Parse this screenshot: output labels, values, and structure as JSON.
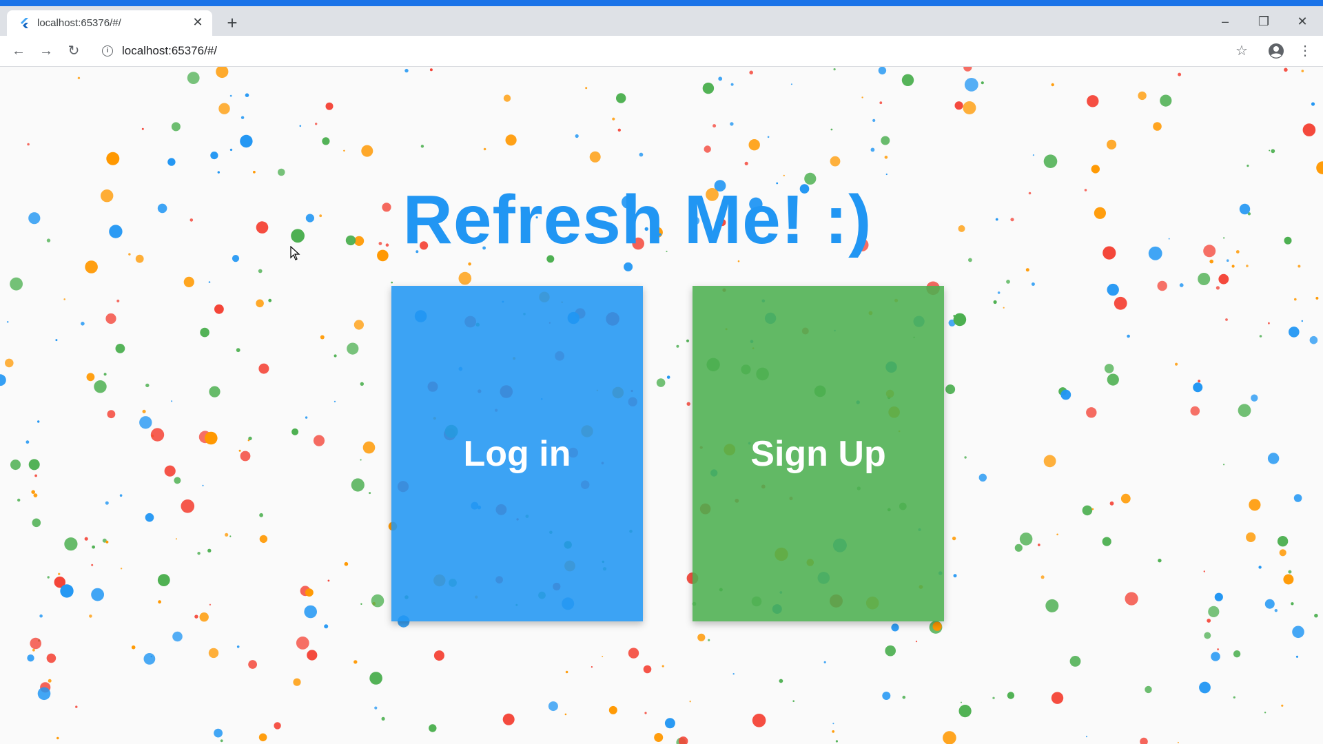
{
  "browser": {
    "tab_title": "localhost:65376/#/",
    "url": "localhost:65376/#/",
    "new_tab_icon": "plus-icon",
    "colors": {
      "accent": "#1a73e8",
      "tabbar": "#dee1e6"
    }
  },
  "page": {
    "title": "Refresh Me! :)",
    "login_label": "Log in",
    "signup_label": "Sign Up",
    "colors": {
      "title": "#2196f3",
      "login": "#2196f3",
      "signup": "#4caf50",
      "confetti": [
        "#f44336",
        "#2196f3",
        "#4caf50",
        "#ff9800"
      ]
    }
  }
}
